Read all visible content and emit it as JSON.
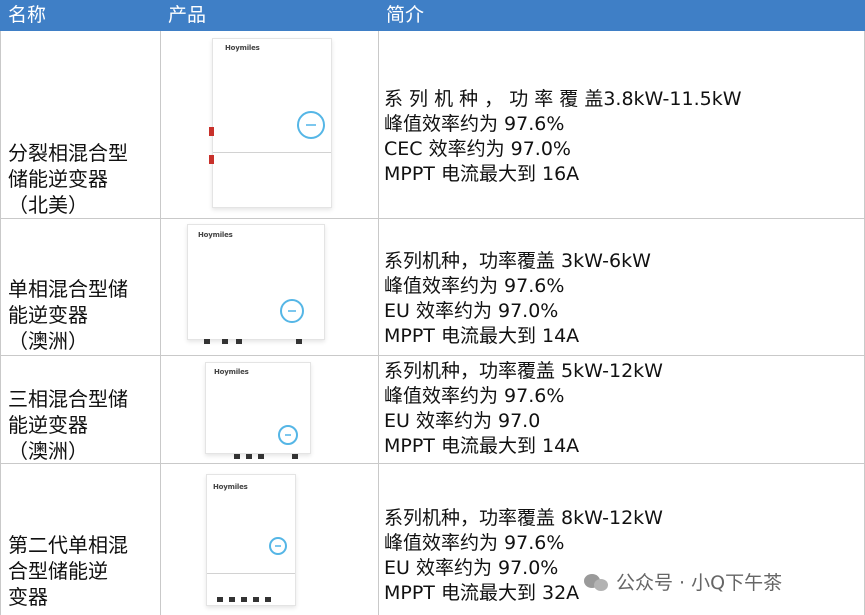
{
  "header": {
    "col_name": "名称",
    "col_product": "产品",
    "col_intro": "简介"
  },
  "rows": [
    {
      "name_lines": [
        "分裂相混合型",
        "储能逆变器",
        "（北美）"
      ],
      "logo_text": "Hoymiles",
      "desc": [
        "系 列 机 种 ， 功 率 覆 盖3.8kW-11.5kW",
        "峰值效率约为 97.6%",
        "CEC 效率约为 97.0%",
        "MPPT 电流最大到 16A"
      ]
    },
    {
      "name_lines": [
        "单相混合型储",
        "能逆变器",
        "（澳洲）"
      ],
      "logo_text": "Hoymiles",
      "desc": [
        "系列机种，功率覆盖 3kW-6kW",
        "峰值效率约为 97.6%",
        "EU 效率约为 97.0%",
        "MPPT 电流最大到 14A"
      ]
    },
    {
      "name_lines": [
        "三相混合型储",
        "能逆变器",
        "（澳洲）"
      ],
      "logo_text": "Hoymiles",
      "desc": [
        "系列机种，功率覆盖 5kW-12kW",
        "峰值效率约为 97.6%",
        "EU 效率约为 97.0",
        "MPPT 电流最大到 14A"
      ]
    },
    {
      "name_lines": [
        "第二代单相混",
        "合型储能逆",
        "变器"
      ],
      "logo_text": "Hoymiles",
      "desc": [
        "系列机种，功率覆盖 8kW-12kW",
        "峰值效率约为 97.6%",
        "EU 效率约为 97.0%",
        "MPPT 电流最大到 32A"
      ]
    }
  ],
  "watermark": {
    "text": "公众号 · 小Q下午茶",
    "icon": "wechat-official-account-icon"
  },
  "colors": {
    "header_bg": "#3f7fc6",
    "header_text": "#ffffff",
    "grid": "#c9c9c9",
    "accent_ring": "#55b6e6"
  }
}
